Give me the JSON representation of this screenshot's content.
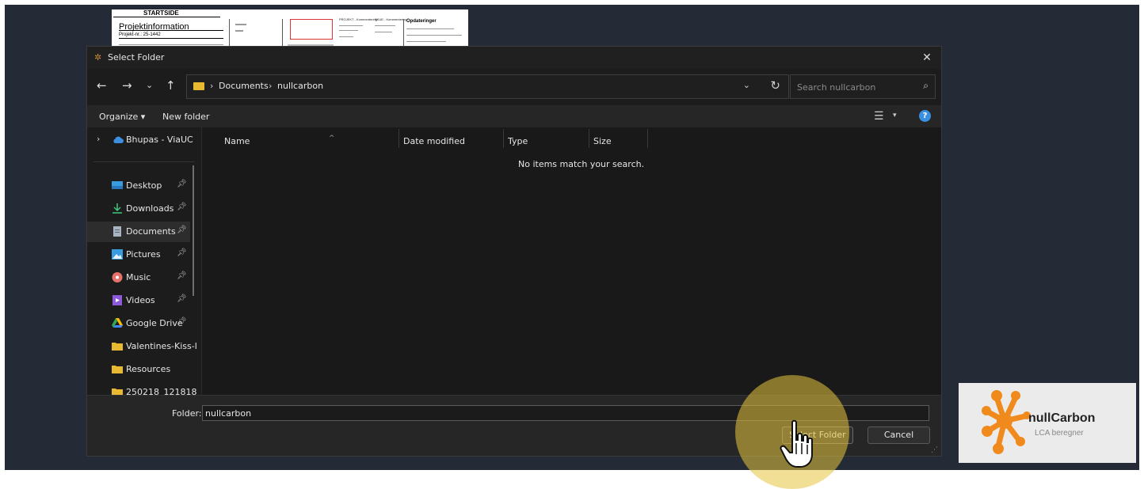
{
  "background_doc": {
    "header": "STARTSIDE",
    "title": "Projektinformation",
    "line": "Projekt-nr.:  25-1442",
    "col_headings": [
      "PROJEKT - Kommentering",
      "SKUE - Kommentering",
      "Opdateringer"
    ]
  },
  "dialog": {
    "title": "Select Folder",
    "address": {
      "crumbs": [
        "Documents",
        "nullcarbon"
      ]
    },
    "search": {
      "placeholder": "Search nullcarbon"
    },
    "toolbar": {
      "organize": "Organize",
      "new_folder": "New folder"
    },
    "nav_items": [
      {
        "label": "Bhupas - ViaUC",
        "icon": "cloud-icon",
        "color": "#3a8fe0"
      },
      {
        "label": "Desktop",
        "icon": "desktop-icon",
        "color": "#3a9ce0",
        "pinned": true
      },
      {
        "label": "Downloads",
        "icon": "download-icon",
        "color": "#3ec87a",
        "pinned": true
      },
      {
        "label": "Documents",
        "icon": "document-icon",
        "color": "#a9b4c2",
        "pinned": true,
        "active": true
      },
      {
        "label": "Pictures",
        "icon": "picture-icon",
        "color": "#3a9ce0",
        "pinned": true
      },
      {
        "label": "Music",
        "icon": "music-icon",
        "color": "#e5726a",
        "pinned": true
      },
      {
        "label": "Videos",
        "icon": "video-icon",
        "color": "#8d5ad9",
        "pinned": true
      },
      {
        "label": "Google Drive",
        "icon": "google-drive-icon",
        "color": "#34a853",
        "pinned": true
      },
      {
        "label": "Valentines-Kiss-l",
        "icon": "folder-icon",
        "color": "#e8b931"
      },
      {
        "label": "Resources",
        "icon": "folder-icon",
        "color": "#e8b931"
      },
      {
        "label": "250218_121818",
        "icon": "folder-icon",
        "color": "#e8b931"
      }
    ],
    "columns": [
      "Name",
      "Date modified",
      "Type",
      "Size"
    ],
    "empty_message": "No items match your search.",
    "footer": {
      "folder_label": "Folder:",
      "folder_value": "nullcarbon",
      "select_button": "Select Folder",
      "cancel_button": "Cancel"
    }
  },
  "logo": {
    "name": "nullCarbon",
    "tagline": "LCA beregner",
    "color": "#f08a1c"
  }
}
